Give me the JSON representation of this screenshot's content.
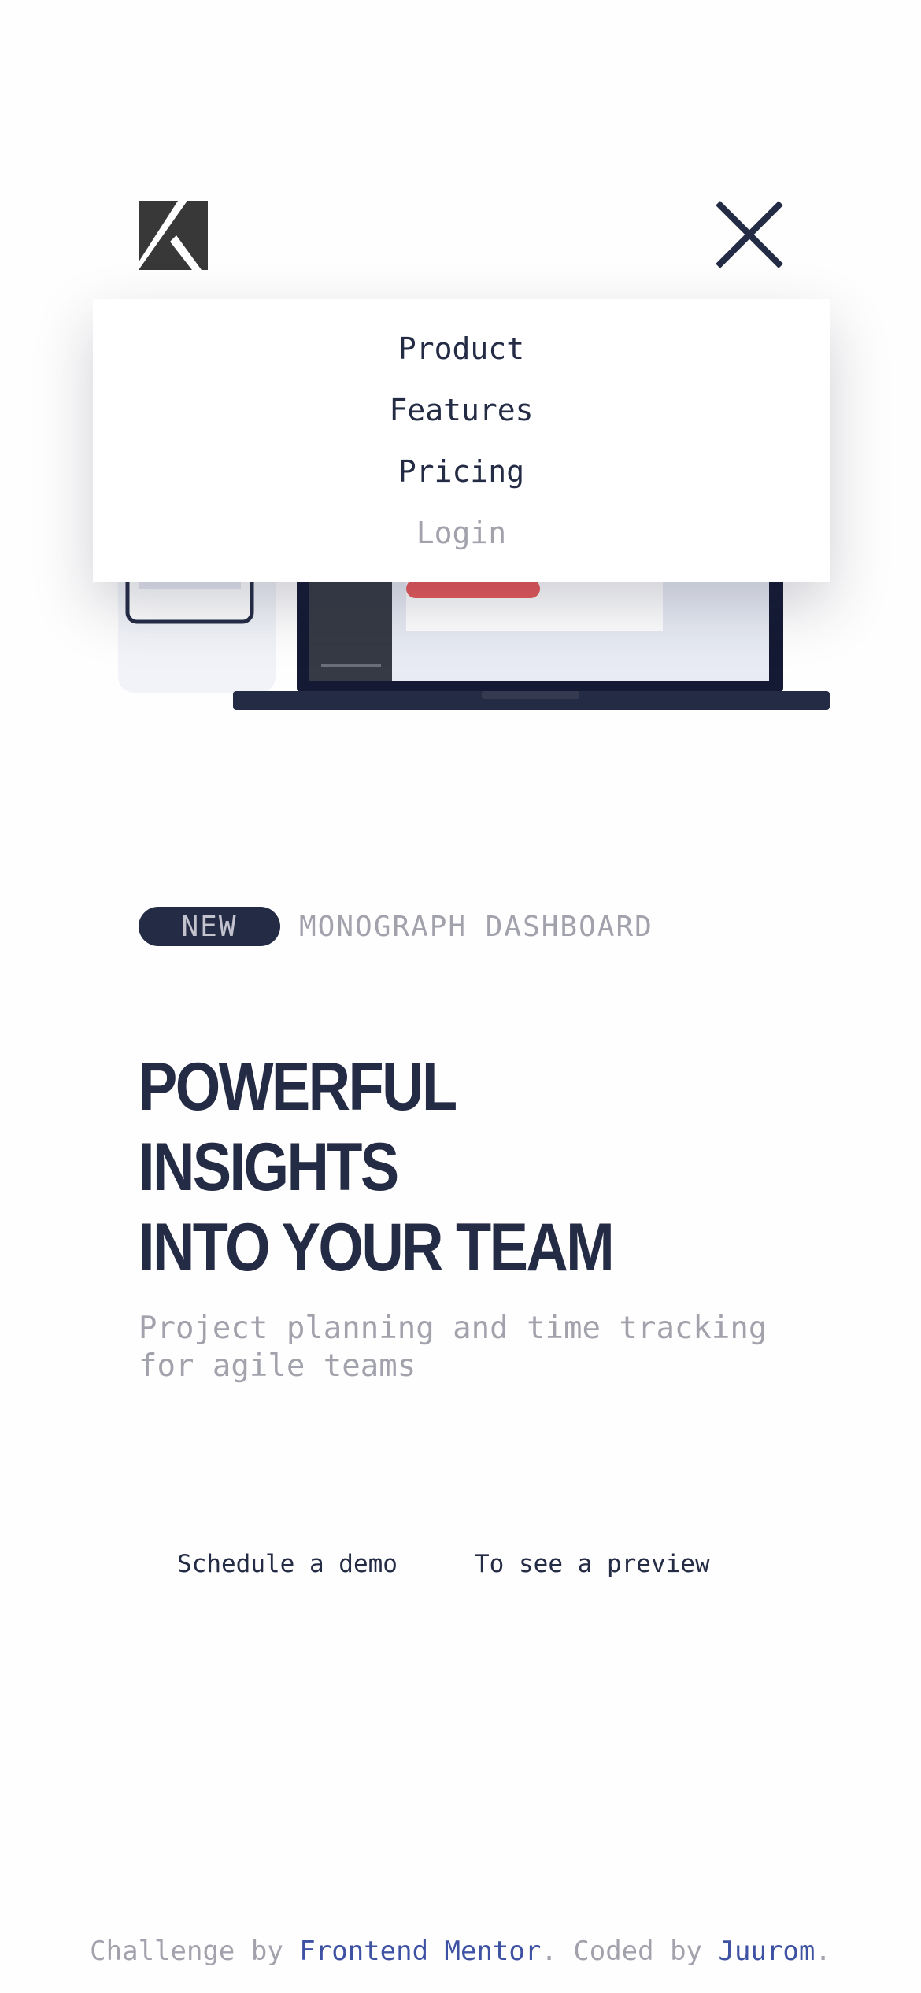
{
  "brand": {
    "logo_icon": "monograph-logo-icon"
  },
  "header": {
    "close_icon": "close-icon"
  },
  "nav": {
    "items": [
      {
        "label": "Product"
      },
      {
        "label": "Features"
      },
      {
        "label": "Pricing"
      },
      {
        "label": "Login"
      }
    ]
  },
  "hero": {
    "badge": "NEW",
    "badge_label": "MONOGRAPH DASHBOARD",
    "title_line1": "POWERFUL INSIGHTS",
    "title_line2": "INTO YOUR TEAM",
    "subtitle": "Project planning and time tracking for agile teams",
    "cta_primary": "Schedule a demo",
    "cta_secondary": "To see a preview"
  },
  "footer": {
    "prefix": "Challenge by ",
    "challenge_link": "Frontend Mentor",
    "middle": ". Coded by ",
    "author_link": "Juurom",
    "suffix": "."
  },
  "colors": {
    "dark_navy": "#242b45",
    "muted_gray": "#a2a2ad",
    "accent_red": "#e85a5a",
    "link_blue": "#3e52a3",
    "logo_gray": "#383838"
  }
}
